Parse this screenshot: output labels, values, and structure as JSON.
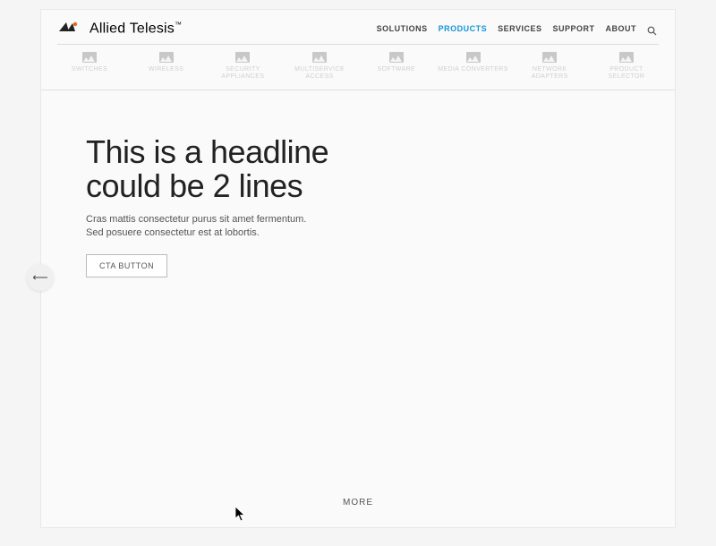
{
  "brand": {
    "name_bold": "Allied",
    "name_light": "Telesis",
    "tm": "™"
  },
  "topnav": {
    "items": [
      {
        "label": "SOLUTIONS",
        "active": false
      },
      {
        "label": "PRODUCTS",
        "active": true
      },
      {
        "label": "SERVICES",
        "active": false
      },
      {
        "label": "SUPPORT",
        "active": false
      },
      {
        "label": "ABOUT",
        "active": false
      }
    ]
  },
  "categories": {
    "items": [
      {
        "label": "SWITCHES"
      },
      {
        "label": "WIRELESS"
      },
      {
        "label": "SECURITY APPLIANCES"
      },
      {
        "label": "MULTISERVICE ACCESS"
      },
      {
        "label": "SOFTWARE"
      },
      {
        "label": "MEDIA CONVERTERS"
      },
      {
        "label": "NETWORK ADAPTERS"
      },
      {
        "label": "PRODUCT SELECTOR"
      }
    ]
  },
  "hero": {
    "headline_l1": "This is a headline",
    "headline_l2": "could be 2 lines",
    "body_l1": "Cras mattis consectetur purus sit amet fermentum.",
    "body_l2": "Sed posuere consectetur est at lobortis.",
    "cta": "CTA BUTTON"
  },
  "more_label": "MORE",
  "colors": {
    "accent": "#1594d8"
  }
}
